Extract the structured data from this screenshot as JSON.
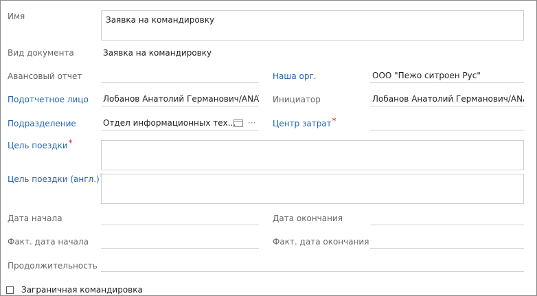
{
  "fields": {
    "name_label": "Имя",
    "name_value": "Заявка на командировку",
    "doc_type_label": "Вид документа",
    "doc_type_value": "Заявка на командировку",
    "advance_report_label": "Авансовый отчет",
    "advance_report_value": "",
    "our_org_label": "Наша орг.",
    "our_org_value": "ООО \"Пежо ситроен Рус\"",
    "accountable_label": "Подотчетное лицо",
    "accountable_value": "Лобанов Анатолий Германович/ANATOLY LOBANOV",
    "initiator_label": "Инициатор",
    "initiator_value": "Лобанов Анатолий Германович/ANATOLY LOBANOV",
    "department_label": "Подразделение",
    "department_value": "Отдел информационных тех...",
    "cost_center_label": "Центр затрат",
    "cost_center_value": "",
    "trip_goal_label": "Цель поездки",
    "trip_goal_value": "",
    "trip_goal_en_label": "Цель поездки (англ.)",
    "trip_goal_en_value": "",
    "start_date_label": "Дата начала",
    "start_date_value": "",
    "end_date_label": "Дата окончания",
    "end_date_value": "",
    "fact_start_label": "Факт. дата начала",
    "fact_start_value": "",
    "fact_end_label": "Факт. дата окончания",
    "fact_end_value": "",
    "duration_label": "Продолжительность",
    "duration_value": "",
    "foreign_trip_label": "Заграничная командировка",
    "required_mark": "*"
  },
  "colors": {
    "link": "#1e64b4",
    "required": "#e0201f",
    "label": "#666666"
  },
  "icons": {
    "department_lookup": "card-icon",
    "department_more": "ellipsis-icon"
  }
}
